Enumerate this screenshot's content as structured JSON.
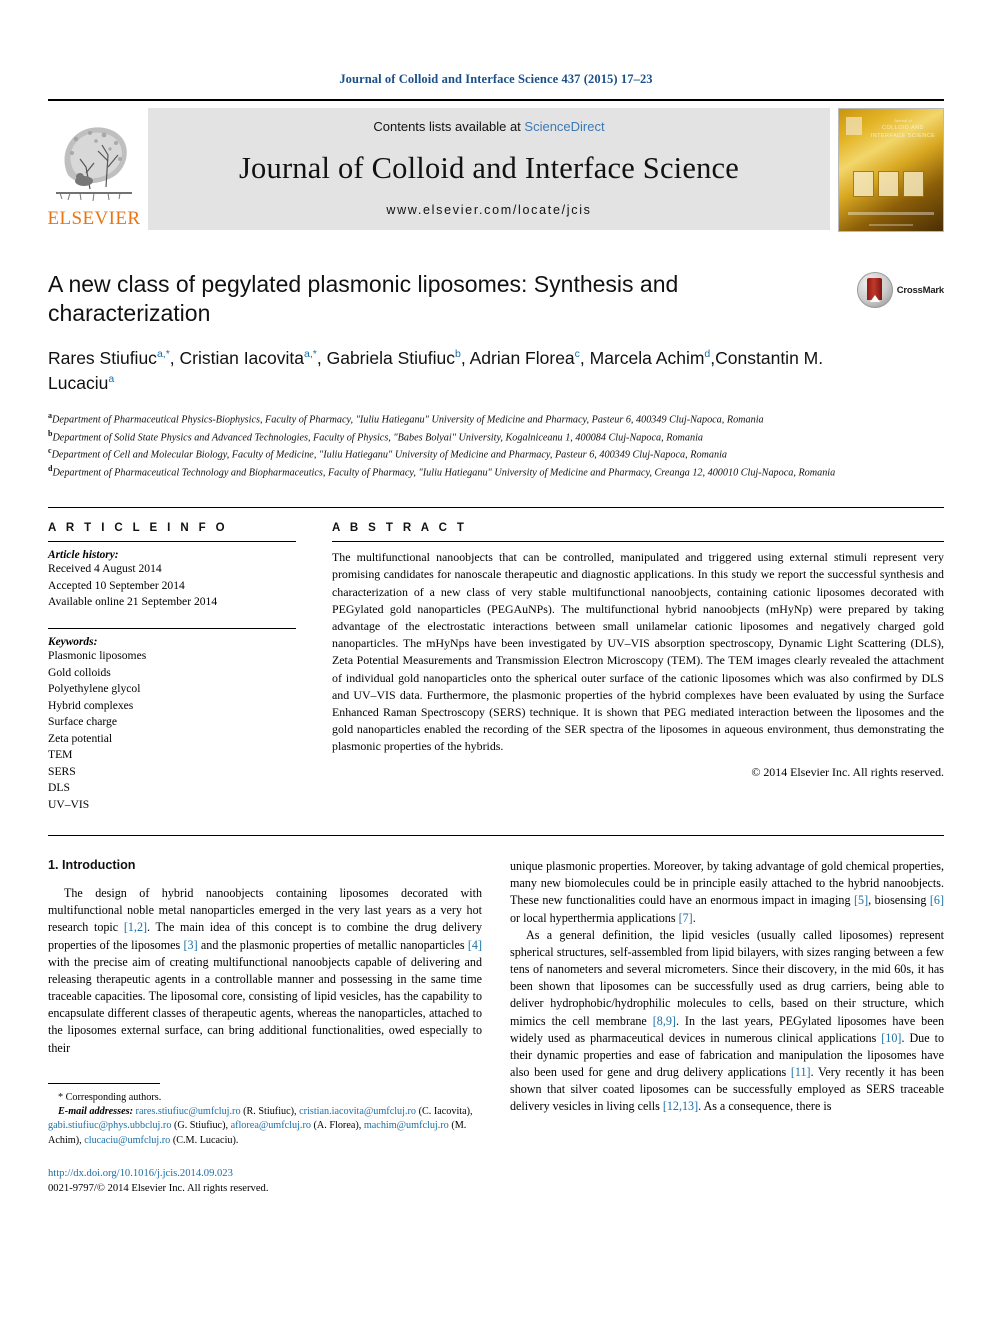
{
  "running_head": "Journal of Colloid and Interface Science 437 (2015) 17–23",
  "masthead": {
    "contents_prefix": "Contents lists available at ",
    "sciencedirect": "ScienceDirect",
    "journal_name": "Journal of Colloid and Interface Science",
    "journal_url": "www.elsevier.com/locate/jcis",
    "publisher_word": "ELSEVIER",
    "cover_title_small": "Journal of",
    "cover_title": "COLLOID AND INTERFACE SCIENCE"
  },
  "crossmark": {
    "label": "CrossMark"
  },
  "title": "A new class of pegylated plasmonic liposomes: Synthesis and characterization",
  "authors": [
    {
      "name": "Rares Stiufiuc",
      "marks": "a,*",
      "sep": ", "
    },
    {
      "name": "Cristian Iacovita",
      "marks": "a,*",
      "sep": ", "
    },
    {
      "name": "Gabriela Stiufiuc",
      "marks": "b",
      "sep": ", "
    },
    {
      "name": "Adrian Florea",
      "marks": "c",
      "sep": ", "
    },
    {
      "name": "Marcela Achim",
      "marks": "d",
      "sep": ","
    },
    {
      "name": "Constantin M. Lucaciu",
      "marks": "a",
      "sep": ""
    }
  ],
  "affiliations": [
    {
      "mark": "a",
      "text": "Department of Pharmaceutical Physics-Biophysics, Faculty of Pharmacy, \"Iuliu Hatieganu\" University of Medicine and Pharmacy, Pasteur 6, 400349 Cluj-Napoca, Romania"
    },
    {
      "mark": "b",
      "text": "Department of Solid State Physics and Advanced Technologies, Faculty of Physics, \"Babes Bolyai\" University, Kogalniceanu 1, 400084 Cluj-Napoca, Romania"
    },
    {
      "mark": "c",
      "text": "Department of Cell and Molecular Biology, Faculty of Medicine, \"Iuliu Hatieganu\" University of Medicine and Pharmacy, Pasteur 6, 400349 Cluj-Napoca, Romania"
    },
    {
      "mark": "d",
      "text": "Department of Pharmaceutical Technology and Biopharmaceutics, Faculty of Pharmacy, \"Iuliu Hatieganu\" University of Medicine and Pharmacy, Creanga 12, 400010 Cluj-Napoca, Romania"
    }
  ],
  "article_info": {
    "heading": "A R T I C L E    I N F O",
    "history_label": "Article history:",
    "history": [
      "Received 4 August 2014",
      "Accepted 10 September 2014",
      "Available online 21 September 2014"
    ],
    "keywords_label": "Keywords:",
    "keywords": [
      "Plasmonic liposomes",
      "Gold colloids",
      "Polyethylene glycol",
      "Hybrid complexes",
      "Surface charge",
      "Zeta potential",
      "TEM",
      "SERS",
      "DLS",
      "UV–VIS"
    ]
  },
  "abstract": {
    "heading": "A B S T R A C T",
    "text": "The multifunctional nanoobjects that can be controlled, manipulated and triggered using external stimuli represent very promising candidates for nanoscale therapeutic and diagnostic applications. In this study we report the successful synthesis and characterization of a new class of very stable multifunctional nanoobjects, containing cationic liposomes decorated with PEGylated gold nanoparticles (PEGAuNPs). The multifunctional hybrid nanoobjects (mHyNp) were prepared by taking advantage of the electrostatic interactions between small unilamelar cationic liposomes and negatively charged gold nanoparticles. The mHyNps have been investigated by UV–VIS absorption spectroscopy, Dynamic Light Scattering (DLS), Zeta Potential Measurements and Transmission Electron Microscopy (TEM). The TEM images clearly revealed the attachment of individual gold nanoparticles onto the spherical outer surface of the cationic liposomes which was also confirmed by DLS and UV–VIS data. Furthermore, the plasmonic properties of the hybrid complexes have been evaluated by using the Surface Enhanced Raman Spectroscopy (SERS) technique. It is shown that PEG mediated interaction between the liposomes and the gold nanoparticles enabled the recording of the SER spectra of the liposomes in aqueous environment, thus demonstrating the plasmonic properties of the hybrids.",
    "copyright": "© 2014 Elsevier Inc. All rights reserved."
  },
  "body": {
    "section_heading": "1. Introduction",
    "left_paragraph_1": "The design of hybrid nanoobjects containing liposomes decorated with multifunctional noble metal nanoparticles emerged in the very last years as a very hot research topic [1,2]. The main idea of this concept is to combine the drug delivery properties of the liposomes [3] and the plasmonic properties of metallic nanoparticles [4] with the precise aim of creating multifunctional nanoobjects capable of delivering and releasing therapeutic agents in a controllable manner and possessing in the same time traceable capacities. The liposomal core, consisting of lipid vesicles, has the capability to encapsulate different classes of therapeutic agents, whereas the nanoparticles, attached to the liposomes external surface, can bring additional functionalities, owed especially to their",
    "right_paragraph_1": "unique plasmonic properties. Moreover, by taking advantage of gold chemical properties, many new biomolecules could be in principle easily attached to the hybrid nanoobjects. These new functionalities could have an enormous impact in imaging [5], biosensing [6] or local hyperthermia applications [7].",
    "right_paragraph_2": "As a general definition, the lipid vesicles (usually called liposomes) represent spherical structures, self-assembled from lipid bilayers, with sizes ranging between a few tens of nanometers and several micrometers. Since their discovery, in the mid 60s, it has been shown that liposomes can be successfully used as drug carriers, being able to deliver hydrophobic/hydrophilic molecules to cells, based on their structure, which mimics the cell membrane [8,9]. In the last years, PEGylated liposomes have been widely used as pharmaceutical devices in numerous clinical applications [10]. Due to their dynamic properties and ease of fabrication and manipulation the liposomes have also been used for gene and drug delivery applications [11]. Very recently it has been shown that silver coated liposomes can be successfully employed as SERS traceable delivery vesicles in living cells [12,13]. As a consequence, there is"
  },
  "footnote": {
    "corresponding": "* Corresponding authors.",
    "email_label": "E-mail addresses:",
    "emails": [
      {
        "address": "rares.stiufiuc@umfcluj.ro",
        "owner": "(R. Stiufiuc),"
      },
      {
        "address": "cristian.iacovita@umfcluj.ro",
        "owner": "(C. Iacovita),"
      },
      {
        "address": "gabi.stiufiuc@phys.ubbcluj.ro",
        "owner": "(G. Stiufiuc),"
      },
      {
        "address": "aflorea@umfcluj.ro",
        "owner": "(A. Florea),"
      },
      {
        "address": "machim@umfcluj.ro",
        "owner": "(M. Achim),"
      },
      {
        "address": "clucaciu@umfcluj.ro",
        "owner": "(C.M. Lucaciu)."
      }
    ],
    "doi": "http://dx.doi.org/10.1016/j.jcis.2014.09.023",
    "issn_line": "0021-9797/© 2014 Elsevier Inc. All rights reserved."
  },
  "colors": {
    "link": "#1a6fa8",
    "running_head": "#1a4f8a",
    "elsevier_orange": "#E87511",
    "masthead_bg": "#e3e3e3"
  }
}
